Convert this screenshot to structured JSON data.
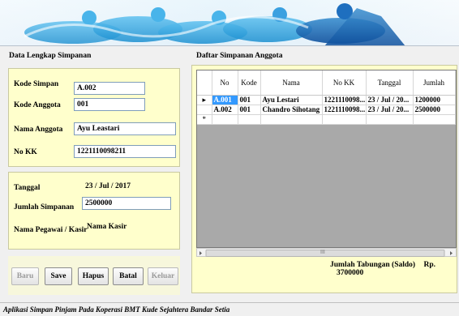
{
  "left_group_title": "Data Lengkap Simpanan",
  "right_group_title": "Daftar Simpanan Anggota",
  "form": {
    "kode_simpan": {
      "label": "Kode Simpan",
      "value": "A.002"
    },
    "kode_anggota": {
      "label": "Kode Anggota",
      "value": "001"
    },
    "nama_anggota": {
      "label": "Nama Anggota",
      "value": "Ayu Leastari"
    },
    "no_kk": {
      "label": "No KK",
      "value": "1221110098211"
    },
    "tanggal": {
      "label": "Tanggal",
      "value": "23 / Jul / 2017"
    },
    "jumlah_simpanan": {
      "label": "Jumlah Simpanan",
      "value": "2500000"
    },
    "nama_pegawai": {
      "label": "Nama Pegawai / Kasir",
      "value": "Nama Kasir"
    }
  },
  "buttons": {
    "baru": "Baru",
    "save": "Save",
    "hapus": "Hapus",
    "batal": "Batal",
    "keluar": "Keluar"
  },
  "grid": {
    "columns": [
      "No",
      "Kode",
      "Nama",
      "No KK",
      "Tanggal",
      "Jumlah"
    ],
    "rows": [
      {
        "marker": "▸",
        "no": "A.001",
        "kode": "001",
        "nama": "Ayu Lestari",
        "no_kk": "1221110098...",
        "tanggal": "23 / Jul / 20...",
        "jumlah": "1200000"
      },
      {
        "marker": "",
        "no": "A.002",
        "kode": "001",
        "nama": "Chandro Sihotang",
        "no_kk": "1221110098...",
        "tanggal": "23 / Jul / 20...",
        "jumlah": "2500000"
      }
    ],
    "new_row_marker": "*",
    "scroll_grip": "III"
  },
  "saldo": {
    "label": "Jumlah Tabungan (Saldo)",
    "currency": "Rp.",
    "value": "3700000"
  },
  "status_bar": "Aplikasi Simpan Pinjam Pada Koperasi  BMT Kude Sejahtera Bandar Setia"
}
